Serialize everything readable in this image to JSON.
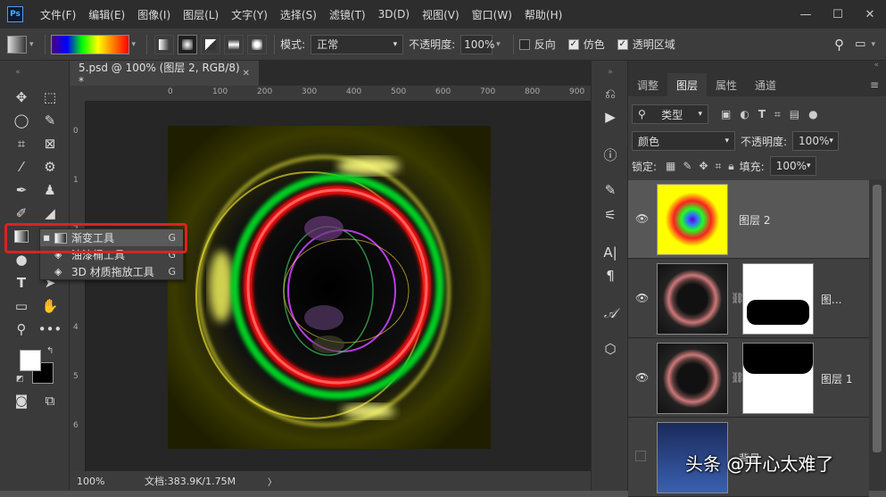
{
  "app": {
    "logo": "Ps"
  },
  "menu": [
    "文件(F)",
    "编辑(E)",
    "图像(I)",
    "图层(L)",
    "文字(Y)",
    "选择(S)",
    "滤镜(T)",
    "3D(D)",
    "视图(V)",
    "窗口(W)",
    "帮助(H)"
  ],
  "window_controls": {
    "minimize": "—",
    "maximize": "☐",
    "close": "✕"
  },
  "options": {
    "mode_label": "模式:",
    "mode_value": "正常",
    "opacity_label": "不透明度:",
    "opacity_value": "100%",
    "reverse_label": "反向",
    "dither_label": "仿色",
    "transparency_label": "透明区域",
    "reverse_checked": false,
    "dither_checked": true,
    "transparency_checked": true
  },
  "document": {
    "tab_title": "5.psd @ 100% (图层 2, RGB/8) *",
    "tab_close": "✕",
    "ruler_h_ticks": [
      "0",
      "100",
      "200",
      "300",
      "400",
      "500",
      "600",
      "700",
      "800",
      "900",
      "100"
    ],
    "ruler_v_ticks": [
      "0",
      "1",
      "2",
      "3",
      "4",
      "5",
      "6"
    ],
    "zoom": "100%",
    "doc_info": "文档:383.9K/1.75M",
    "status_arrow": "〉"
  },
  "flyout": {
    "items": [
      {
        "label": "渐变工具",
        "key": "G",
        "selected": true
      },
      {
        "label": "油漆桶工具",
        "key": "G",
        "selected": false
      },
      {
        "label": "3D 材质拖放工具",
        "key": "G",
        "selected": false
      }
    ]
  },
  "panel": {
    "tabs": [
      "调整",
      "图层",
      "属性",
      "通道"
    ],
    "active_tab": "图层",
    "filter_label": "类型",
    "blend_mode": "颜色",
    "opacity_label": "不透明度:",
    "opacity_value": "100%",
    "lock_label": "锁定:",
    "fill_label": "填充:",
    "fill_value": "100%",
    "layers": [
      {
        "name": "图层 2",
        "selected": true
      },
      {
        "name": "图...",
        "selected": false
      },
      {
        "name": "图层 1",
        "selected": false
      },
      {
        "name": "背景",
        "selected": false
      }
    ]
  },
  "watermark": "头条 @开心太难了",
  "colors": {
    "accent_red": "#e02020",
    "panel_bg": "#3c3c3c",
    "selected_layer": "#575757"
  }
}
